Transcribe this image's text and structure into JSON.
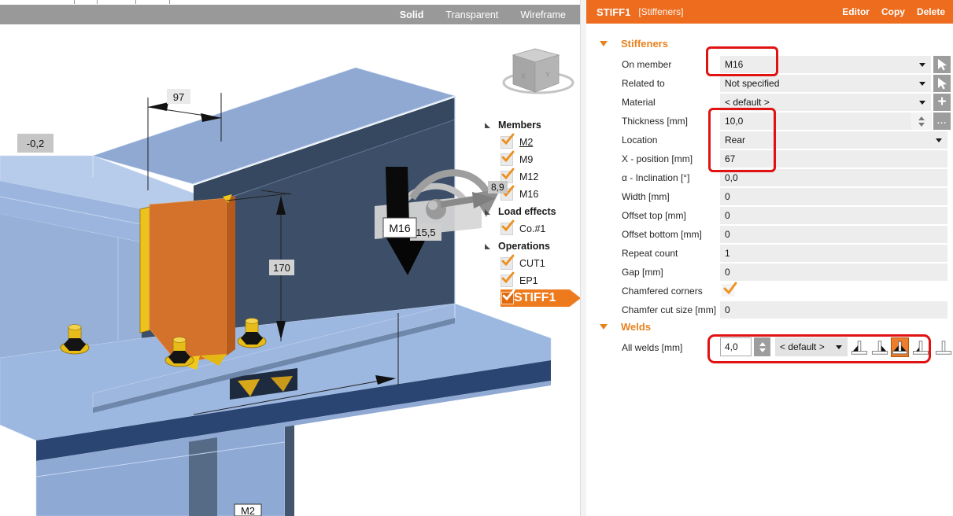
{
  "view_toolbar": {
    "solid": "Solid",
    "transparent": "Transparent",
    "wireframe": "Wireframe"
  },
  "scene": {
    "dim_width": "97",
    "dim_height": "170",
    "offset_label": "-0,2",
    "gap_label": "8,9",
    "weld_label": "15,5",
    "beam_tag": "M16",
    "column_tag": "M2",
    "nav_cube": {
      "x": "X",
      "y": "Y"
    }
  },
  "tree": {
    "groups": [
      {
        "label": "Members",
        "items": [
          {
            "label": "M2",
            "checked": true
          },
          {
            "label": "M9",
            "checked": true
          },
          {
            "label": "M12",
            "checked": true
          },
          {
            "label": "M16",
            "checked": true
          }
        ]
      },
      {
        "label": "Load effects",
        "items": [
          {
            "label": "Co.#1",
            "checked": true
          }
        ]
      },
      {
        "label": "Operations",
        "items": [
          {
            "label": "CUT1",
            "checked": true
          },
          {
            "label": "EP1",
            "checked": true
          },
          {
            "label": "STIFF1",
            "checked": true,
            "selected": true
          }
        ]
      }
    ]
  },
  "panel": {
    "header": {
      "title": "STIFF1",
      "type": "[Stiffeners]",
      "actions": [
        {
          "label": "Editor"
        },
        {
          "label": "Copy"
        },
        {
          "label": "Delete"
        }
      ]
    },
    "stiffeners": {
      "title": "Stiffeners",
      "rows": [
        {
          "label": "On member",
          "value": "M16"
        },
        {
          "label": "Related to",
          "value": "Not specified"
        },
        {
          "label": "Material",
          "value": "< default >"
        },
        {
          "label": "Thickness [mm]",
          "value": "10,0"
        },
        {
          "label": "Location",
          "value": "Rear"
        },
        {
          "label": "X - position [mm]",
          "value": "67"
        },
        {
          "label": "α - Inclination [°]",
          "value": "0,0"
        },
        {
          "label": "Width [mm]",
          "value": "0"
        },
        {
          "label": "Offset top [mm]",
          "value": "0"
        },
        {
          "label": "Offset bottom [mm]",
          "value": "0"
        },
        {
          "label": "Repeat count",
          "value": "1"
        },
        {
          "label": "Gap [mm]",
          "value": "0"
        },
        {
          "label": "Chamfered corners",
          "value": "checked"
        },
        {
          "label": "Chamfer cut size [mm]",
          "value": "0"
        }
      ]
    },
    "welds": {
      "title": "Welds",
      "label": "All welds [mm]",
      "size": "4,0",
      "material": "< default >",
      "selected_weld_type": "double-fillet"
    }
  },
  "colors": {
    "accent": "#ED6C1E",
    "section_title": "#E8821F",
    "highlight_red": "#E01212",
    "check_orange": "#EE9320",
    "selection_orange": "#EE7A1E",
    "steel_light": "#9CB5DE",
    "steel_dark": "#3D4F68",
    "stiffener_orange": "#D4722B",
    "bolt_yellow": "#EFC51F",
    "toolbar_gray": "#999999"
  }
}
